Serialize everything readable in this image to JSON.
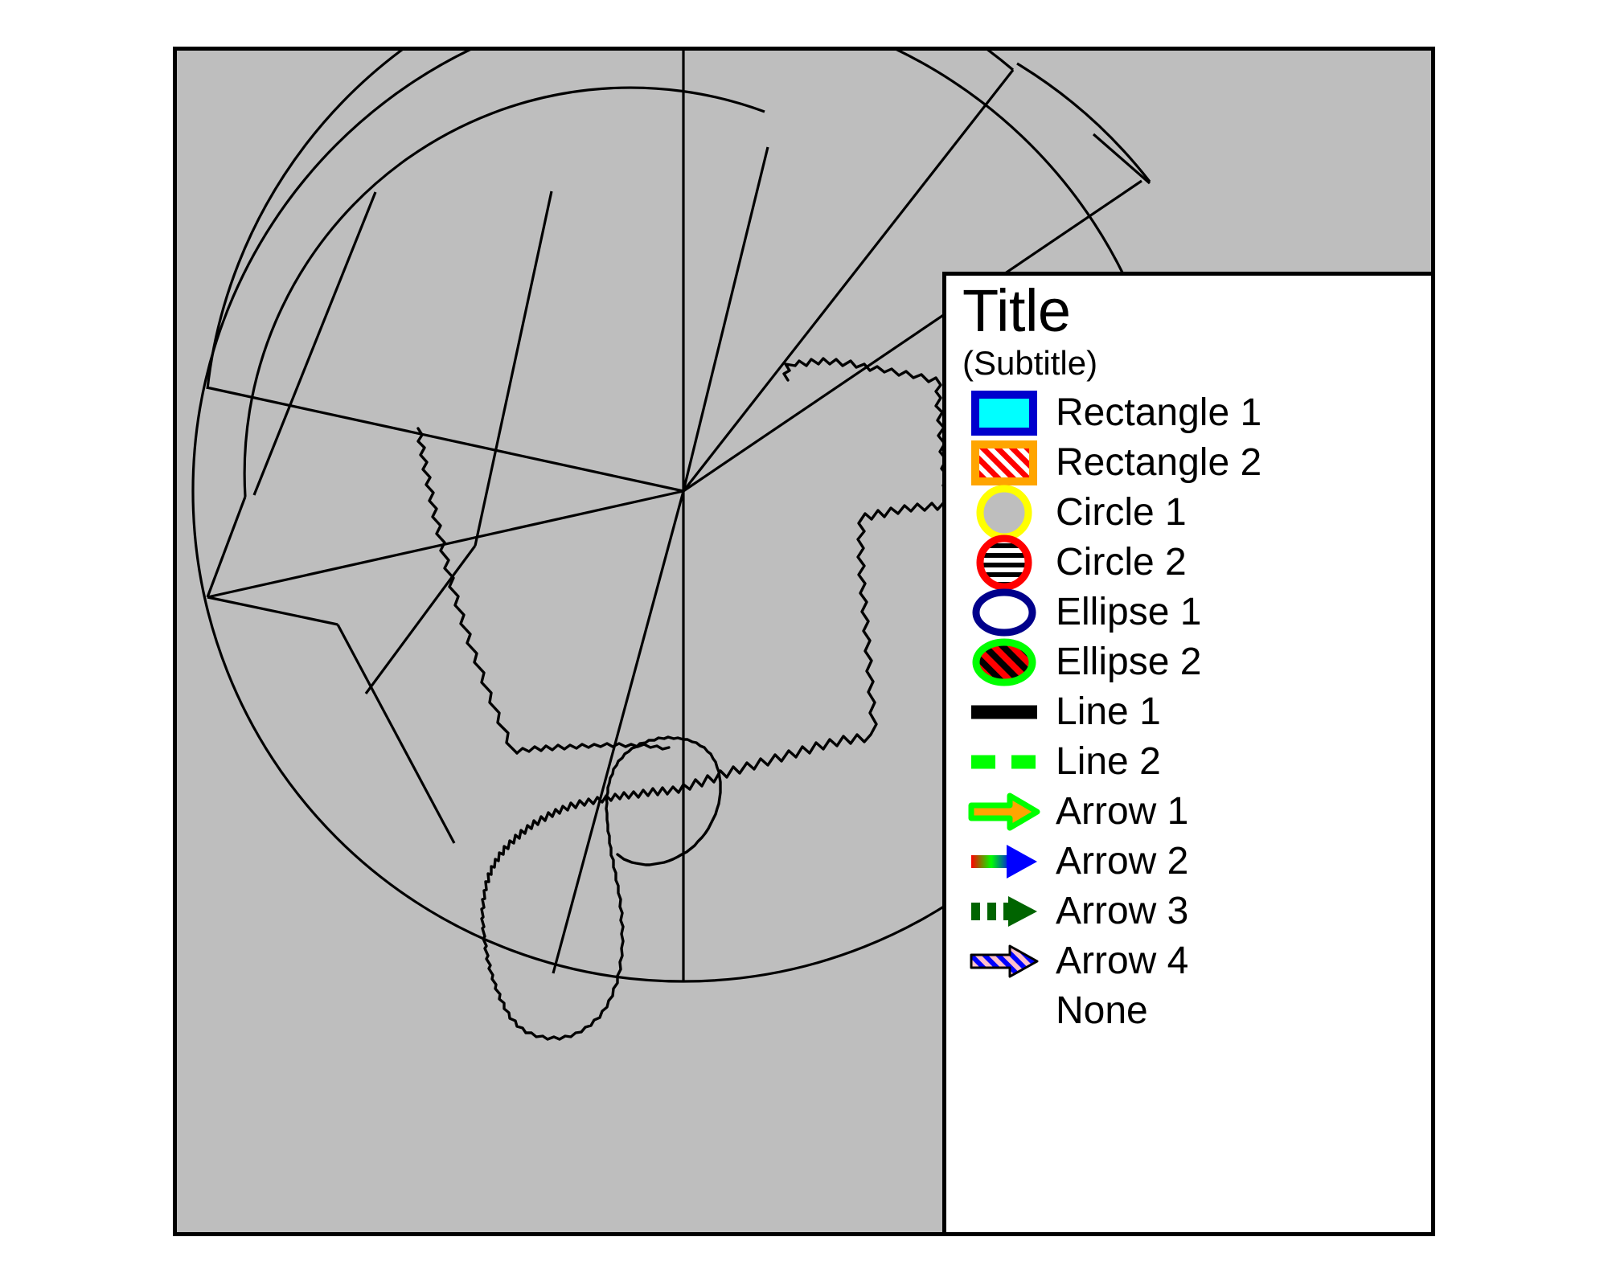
{
  "figure": {
    "background_color": "#ffffff",
    "frame_color": "#000000",
    "map_fill_color": "#bebebe"
  },
  "map": {
    "name": "antarctica-polar-map",
    "description": "Polar stereographic map of Antarctica with graticule sector lines",
    "coastline_color": "#000000",
    "land_fill": "#bebebe"
  },
  "legend": {
    "title": "Title",
    "subtitle": "(Subtitle)",
    "background_color": "#ffffff",
    "border_color": "#000000",
    "items": [
      {
        "label": "Rectangle 1",
        "icon": "rectangle-filled-icon",
        "fill": "#00ffff",
        "stroke": "#0000cd"
      },
      {
        "label": "Rectangle 2",
        "icon": "rectangle-hatched-icon",
        "fill": "#ff0000",
        "stroke": "#ffa500"
      },
      {
        "label": "Circle 1",
        "icon": "circle-filled-icon",
        "fill": "#bebebe",
        "stroke": "#ffff00"
      },
      {
        "label": "Circle 2",
        "icon": "circle-striped-icon",
        "fill": "#000000",
        "stroke": "#ff0000"
      },
      {
        "label": "Ellipse 1",
        "icon": "ellipse-outline-icon",
        "fill": "#ffffff",
        "stroke": "#00008b"
      },
      {
        "label": "Ellipse 2",
        "icon": "ellipse-striped-icon",
        "fill": "#ff0000",
        "stroke": "#00ff00"
      },
      {
        "label": "Line 1",
        "icon": "line-solid-icon",
        "fill": "none",
        "stroke": "#000000"
      },
      {
        "label": "Line 2",
        "icon": "line-dashed-icon",
        "fill": "none",
        "stroke": "#00ff00"
      },
      {
        "label": "Arrow 1",
        "icon": "arrow-filled-icon",
        "fill": "#ffa500",
        "stroke": "#00ff00"
      },
      {
        "label": "Arrow 2",
        "icon": "arrow-gradient-icon",
        "fill": "#0000ff",
        "stroke": "#0000ff"
      },
      {
        "label": "Arrow 3",
        "icon": "arrow-dashed-icon",
        "fill": "#006400",
        "stroke": "#006400"
      },
      {
        "label": "Arrow 4",
        "icon": "arrow-hatched-icon",
        "fill": "#ffc0cb",
        "stroke": "#0000ff"
      },
      {
        "label": "None",
        "icon": "none-icon",
        "fill": "none",
        "stroke": "none"
      }
    ]
  }
}
